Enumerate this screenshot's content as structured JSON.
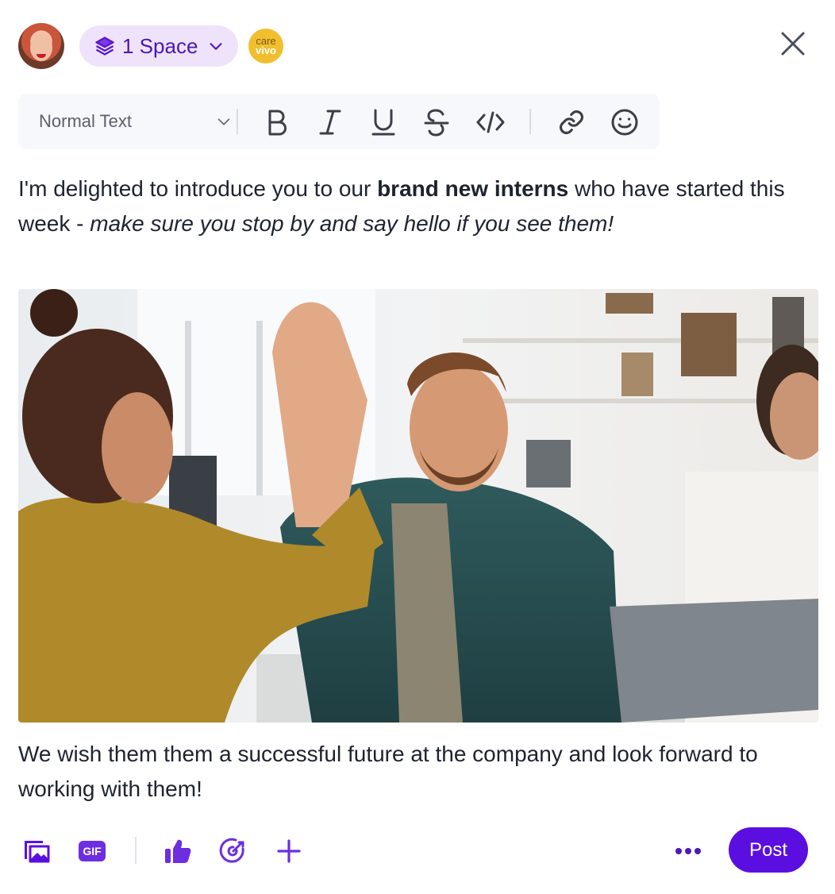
{
  "header": {
    "space_selector": "1 Space",
    "brand_logo": {
      "line1": "care",
      "line2": "vivo"
    },
    "icons": [
      "avatar",
      "layers-icon",
      "chevron-down-icon",
      "close-icon"
    ]
  },
  "toolbar": {
    "text_style": "Normal Text",
    "buttons": [
      "bold",
      "italic",
      "underline",
      "strikethrough",
      "code",
      "link",
      "emoji"
    ]
  },
  "post": {
    "intro_1": "I'm delighted to introduce you to our ",
    "intro_bold": "brand new interns",
    "intro_2": " who have started this week - ",
    "intro_italic": "make sure you stop by and say hello if you see them!",
    "closing": "We wish them them a successful future at the company and look forward to working with them!"
  },
  "footer": {
    "gif_label": "GIF",
    "post_label": "Post",
    "icons": [
      "image-gallery-icon",
      "gif-icon",
      "thumbs-up-icon",
      "target-icon",
      "plus-icon",
      "more-icon"
    ]
  },
  "colors": {
    "accent": "#5a0fe0",
    "pill_bg": "#efe3fc",
    "toolbar_bg": "#f7f8fb"
  }
}
